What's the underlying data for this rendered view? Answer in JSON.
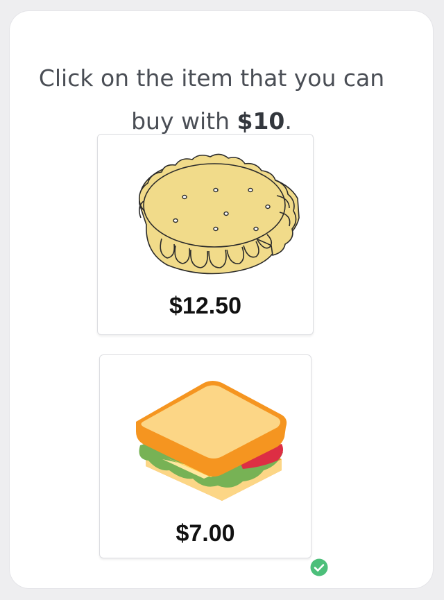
{
  "question": {
    "prefix": "Click on the item that you can buy with ",
    "amount": "$10",
    "suffix": "."
  },
  "options": [
    {
      "item": "pie",
      "price": "$12.50",
      "correct": false
    },
    {
      "item": "sandwich",
      "price": "$7.00",
      "correct": true
    }
  ],
  "colors": {
    "pie_fill": "#f1db8a",
    "bread": "#fcd686",
    "crust": "#f59520",
    "lettuce": "#77b255",
    "tomato": "#dd2e44",
    "cheese": "#ffe8a0",
    "check": "#4cbf7a"
  }
}
